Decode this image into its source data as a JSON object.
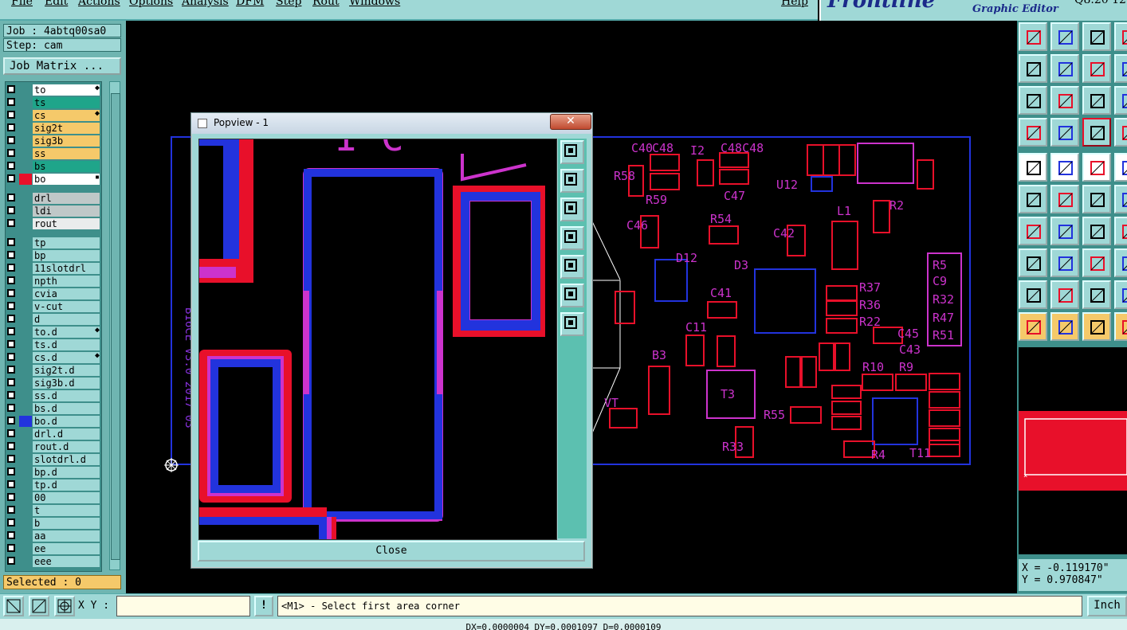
{
  "menubar": {
    "items": [
      "File",
      "Edit",
      "Actions",
      "Options",
      "Analysis",
      "DFM",
      "Step",
      "Rout",
      "Windows"
    ],
    "help": "Help"
  },
  "logo": {
    "text": "Frontline",
    "subtitle": "Graphic Editor",
    "version": "Q8.20 12"
  },
  "job": {
    "label": "Job : 4abtq00sa0",
    "step": "Step: cam",
    "matrix_button": "Job Matrix ..."
  },
  "layers": [
    {
      "name": "to",
      "color": "#ffffff",
      "mark": "◆"
    },
    {
      "name": "ts",
      "color": "#1fa58a"
    },
    {
      "name": "cs",
      "color": "#f5c96a",
      "mark": "◆"
    },
    {
      "name": "sig2t",
      "color": "#f5c96a"
    },
    {
      "name": "sig3b",
      "color": "#f5c96a"
    },
    {
      "name": "ss",
      "color": "#f5c96a"
    },
    {
      "name": "bs",
      "color": "#1fa58a"
    },
    {
      "name": "bo",
      "color": "#ffffff",
      "swatch": "#e8102a",
      "mark": "▪"
    },
    {
      "name": "drl",
      "color": "#bfc8c8"
    },
    {
      "name": "ldi",
      "color": "#bfc8c8"
    },
    {
      "name": "rout",
      "color": "#e9ecec"
    },
    {
      "name": "tp",
      "color": "#9fd8d6"
    },
    {
      "name": "bp",
      "color": "#9fd8d6"
    },
    {
      "name": "11slotdrl",
      "color": "#9fd8d6"
    },
    {
      "name": "npth",
      "color": "#9fd8d6"
    },
    {
      "name": "cvia",
      "color": "#9fd8d6"
    },
    {
      "name": "v-cut",
      "color": "#9fd8d6"
    },
    {
      "name": "d",
      "color": "#9fd8d6"
    },
    {
      "name": "to.d",
      "color": "#9fd8d6",
      "mark": "◆"
    },
    {
      "name": "ts.d",
      "color": "#9fd8d6"
    },
    {
      "name": "cs.d",
      "color": "#9fd8d6",
      "mark": "◆"
    },
    {
      "name": "sig2t.d",
      "color": "#9fd8d6"
    },
    {
      "name": "sig3b.d",
      "color": "#9fd8d6"
    },
    {
      "name": "ss.d",
      "color": "#9fd8d6"
    },
    {
      "name": "bs.d",
      "color": "#9fd8d6"
    },
    {
      "name": "bo.d",
      "color": "#9fd8d6",
      "swatch": "#2233dd"
    },
    {
      "name": "drl.d",
      "color": "#9fd8d6"
    },
    {
      "name": "rout.d",
      "color": "#9fd8d6"
    },
    {
      "name": "slotdrl.d",
      "color": "#9fd8d6"
    },
    {
      "name": "bp.d",
      "color": "#9fd8d6"
    },
    {
      "name": "tp.d",
      "color": "#9fd8d6"
    },
    {
      "name": "00",
      "color": "#9fd8d6"
    },
    {
      "name": "t",
      "color": "#9fd8d6"
    },
    {
      "name": "b",
      "color": "#9fd8d6"
    },
    {
      "name": "aa",
      "color": "#9fd8d6"
    },
    {
      "name": "ee",
      "color": "#9fd8d6"
    },
    {
      "name": "eee",
      "color": "#9fd8d6"
    }
  ],
  "selected": "Selected : 0",
  "popview": {
    "title": "Popview - 1",
    "close_label": "Close"
  },
  "coords": {
    "x": "X = -0.119170\"",
    "y": "Y = 0.970847\""
  },
  "bottom": {
    "xy_label": "X Y :",
    "xy_value": "",
    "warn": "!",
    "status": "<M1> - Select first area corner",
    "unit": "Inch"
  },
  "footer": "DX=0.0000004 DY=0.0001097 D=0.0000109",
  "board_labels": {
    "c40": "C40",
    "c48": "C48",
    "c48b": "C48C48",
    "r58": "R58",
    "r59": "R59",
    "c46": "C46",
    "r54": "R54",
    "c42": "C42",
    "d12": "D12",
    "d3": "D3",
    "c41": "C41",
    "c11": "C11",
    "b3": "B3",
    "t3": "T3",
    "r55": "R55",
    "r33": "R33",
    "l1": "L1",
    "r37": "R37",
    "r36": "R36",
    "r22": "R22",
    "c45": "C45",
    "c43": "C43",
    "r9": "R9",
    "r10": "R10",
    "u12": "U12",
    "r2": "R2",
    "r5": "R5",
    "c9": "C9",
    "r32": "R32",
    "r47": "R47",
    "r51": "R51",
    "t11": "T11",
    "r4": "R4",
    "vt": "VT",
    "i2": "I2",
    "c47": "C47",
    "side": "B16CE V3.0 2017 03"
  }
}
